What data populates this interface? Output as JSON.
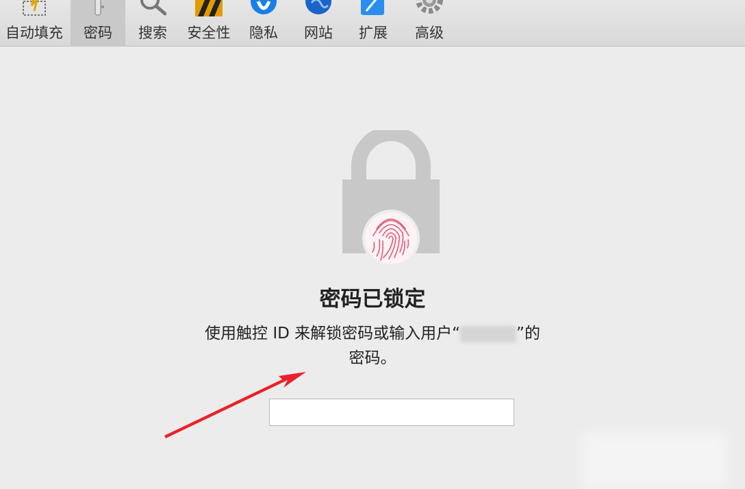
{
  "toolbar": {
    "items": [
      {
        "label": "自动填充",
        "icon": "autofill-icon"
      },
      {
        "label": "密码",
        "icon": "key-icon"
      },
      {
        "label": "搜索",
        "icon": "search-icon"
      },
      {
        "label": "安全性",
        "icon": "security-icon"
      },
      {
        "label": "隐私",
        "icon": "privacy-icon"
      },
      {
        "label": "网站",
        "icon": "globe-icon"
      },
      {
        "label": "扩展",
        "icon": "extensions-icon"
      },
      {
        "label": "高级",
        "icon": "gear-icon"
      }
    ],
    "active_index": 1
  },
  "lock_panel": {
    "title": "密码已锁定",
    "description_prefix": "使用触控 ID 来解锁密码或输入用户“",
    "description_suffix": "”的",
    "description_line2": "密码。",
    "icon": "lock-fingerprint-icon"
  },
  "password_field": {
    "value": "",
    "placeholder": ""
  },
  "colors": {
    "arrow": "#e8222a",
    "fingerprint": "#e05a78",
    "lock": "#c8c8c8"
  }
}
